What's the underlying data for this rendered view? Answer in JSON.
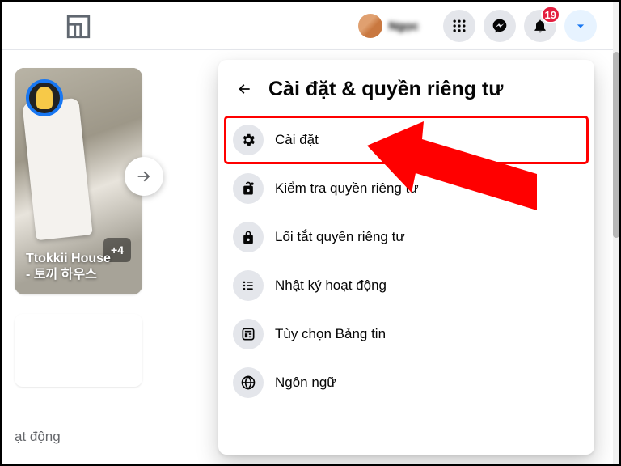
{
  "header": {
    "profile_name": "Ngọc",
    "notif_badge": "19"
  },
  "story": {
    "title": "Ttokkii House\n- 토끼 하우스",
    "more_count": "+4"
  },
  "bottom_label": "ạt động",
  "dropdown": {
    "title": "Cài đặt & quyền riêng tư",
    "items": [
      {
        "label": "Cài đặt",
        "icon": "gear"
      },
      {
        "label": "Kiểm tra quyền riêng tư",
        "icon": "lock-open"
      },
      {
        "label": "Lối tắt quyền riêng tư",
        "icon": "lock"
      },
      {
        "label": "Nhật ký hoạt động",
        "icon": "list"
      },
      {
        "label": "Tùy chọn Bảng tin",
        "icon": "feed"
      },
      {
        "label": "Ngôn ngữ",
        "icon": "globe"
      }
    ]
  }
}
